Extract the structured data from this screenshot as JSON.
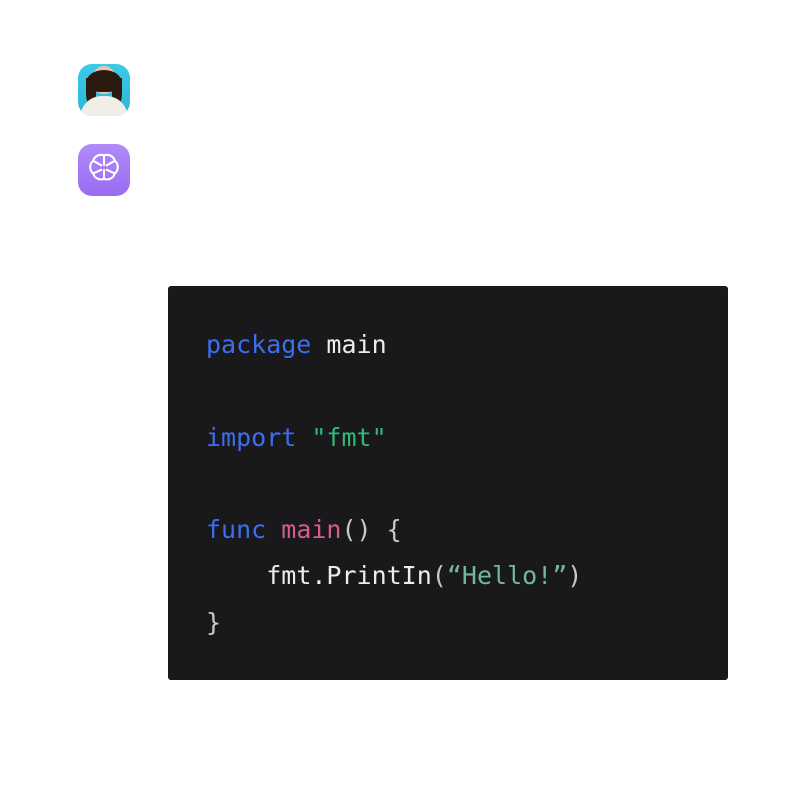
{
  "chat": {
    "user": {
      "avatar_alt": "user-avatar",
      "text": ""
    },
    "assistant": {
      "avatar_alt": "assistant-avatar",
      "text": ""
    }
  },
  "code": {
    "language": "go",
    "tokens": {
      "kw_package": "package",
      "id_main": "main",
      "kw_import": "import",
      "str_fmt": "\"fmt\"",
      "kw_func": "func",
      "fn_main": "main",
      "paren_open": "()",
      "brace_open": "{",
      "call": "fmt.PrintIn",
      "paren_l": "(",
      "str_hello": "“Hello!”",
      "paren_r": ")",
      "brace_close": "}",
      "indent": "    "
    }
  }
}
